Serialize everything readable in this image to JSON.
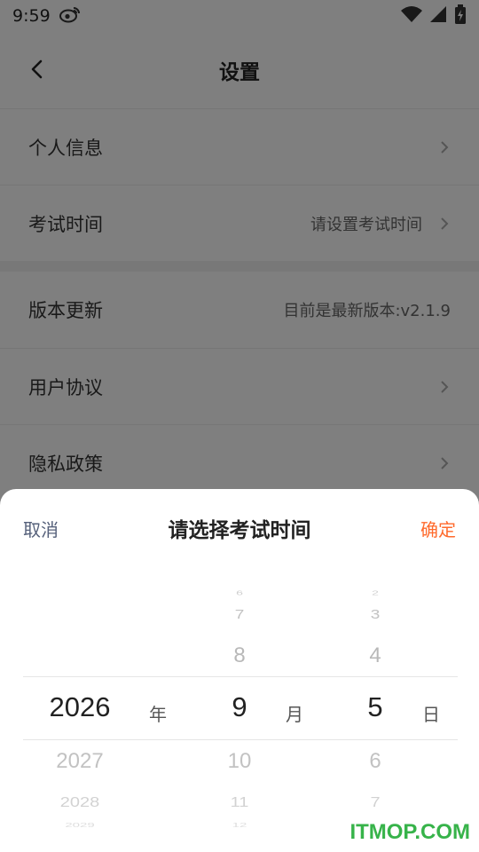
{
  "status_bar": {
    "time": "9:59"
  },
  "header": {
    "title": "设置"
  },
  "settings": {
    "personal_info": "个人信息",
    "exam_time_label": "考试时间",
    "exam_time_value": "请设置考试时间",
    "version_label": "版本更新",
    "version_value": "目前是最新版本:v2.1.9",
    "user_agreement": "用户协议",
    "privacy_policy": "隐私政策"
  },
  "picker_sheet": {
    "cancel_label": "取消",
    "title": "请选择考试时间",
    "confirm_label": "确定",
    "year_unit": "年",
    "month_unit": "月",
    "day_unit": "日",
    "years": {
      "selected": "2026",
      "next1": "2027",
      "next2": "2028",
      "next3": "2029"
    },
    "months": {
      "prev3": "6",
      "prev2": "7",
      "prev1": "8",
      "selected": "9",
      "next1": "10",
      "next2": "11",
      "next3": "12"
    },
    "days": {
      "prev3": "2",
      "prev2": "3",
      "prev1": "4",
      "selected": "5",
      "next1": "6",
      "next2": "7"
    }
  },
  "watermark": "ITMOP.COM",
  "colors": {
    "accent": "#ff6a2c",
    "cancel": "#55607a",
    "watermark": "#37b34a"
  }
}
